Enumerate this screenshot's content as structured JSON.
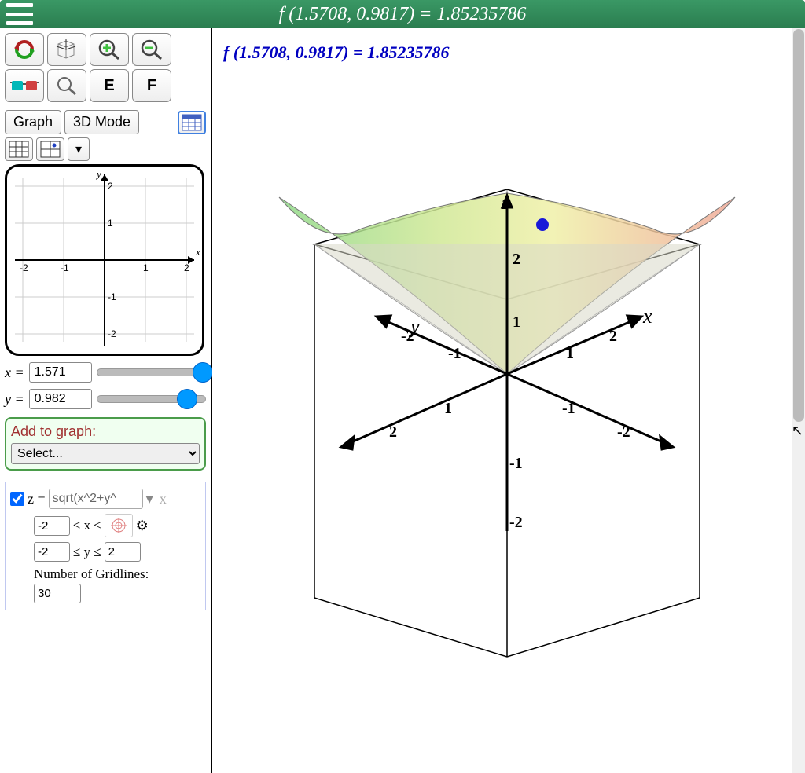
{
  "header": {
    "title": "f (1.5708, 0.9817) = 1.85235786"
  },
  "toolbar": {
    "graph_label": "Graph",
    "mode_label": "3D Mode",
    "e_label": "E",
    "f_label": "F"
  },
  "sliders": {
    "x_label": "x =",
    "x_value": "1.571",
    "x_pos_pct": 88,
    "y_label": "y =",
    "y_value": "0.982",
    "y_pos_pct": 74
  },
  "add_graph": {
    "label": "Add to graph:",
    "selected": "Select..."
  },
  "equation": {
    "checked": true,
    "lhs": "z =",
    "formula": "sqrt(x^2+y^",
    "x_min": "-2",
    "x_range_label": "≤ x ≤",
    "x_max": "",
    "y_min": "-2",
    "y_range_label": "≤ y ≤",
    "y_max": "2",
    "gridlines_label": "Number of Gridlines:",
    "gridlines": "30"
  },
  "plot": {
    "title": "f (1.5708, 0.9817) = 1.85235786"
  },
  "mini_plot": {
    "x_label": "x",
    "y_label": "y",
    "ticks": [
      "-2",
      "-1",
      "1",
      "2"
    ]
  },
  "chart_data": {
    "type": "surface3d",
    "function": "z = sqrt(x^2 + y^2)",
    "x_range": [
      -2,
      2
    ],
    "y_range": [
      -2,
      2
    ],
    "z_range": [
      -2,
      2
    ],
    "gridlines": 30,
    "evaluated_point": {
      "x": 1.5708,
      "y": 0.9817,
      "z": 1.85235786
    },
    "axes": {
      "x": {
        "label": "x",
        "ticks": [
          -2,
          -1,
          1,
          2
        ]
      },
      "y": {
        "label": "y",
        "ticks": [
          -2,
          -1,
          1,
          2
        ]
      },
      "z": {
        "label": "z",
        "ticks": [
          -2,
          -1,
          1,
          2
        ]
      }
    },
    "mini_plot_2d": {
      "x_range": [
        -2,
        2
      ],
      "y_range": [
        -2,
        2
      ],
      "ticks": [
        -2,
        -1,
        1,
        2
      ]
    }
  }
}
